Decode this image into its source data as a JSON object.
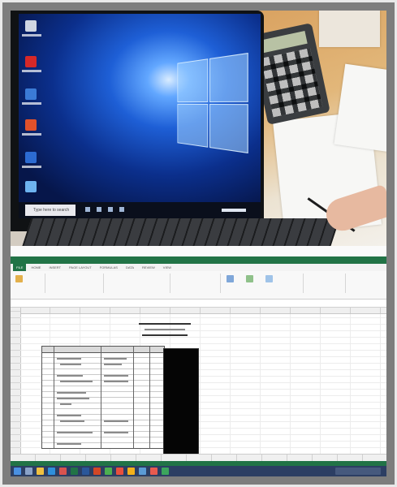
{
  "laptop": {
    "search_placeholder": "Type here to search"
  },
  "spreadsheet": {
    "tabs": [
      "FILE",
      "HOME",
      "INSERT",
      "PAGE LAYOUT",
      "FORMULAS",
      "DATA",
      "REVIEW",
      "VIEW"
    ]
  },
  "colors": {
    "excel_green": "#217346",
    "windows_blue": "#1e5fd6"
  }
}
